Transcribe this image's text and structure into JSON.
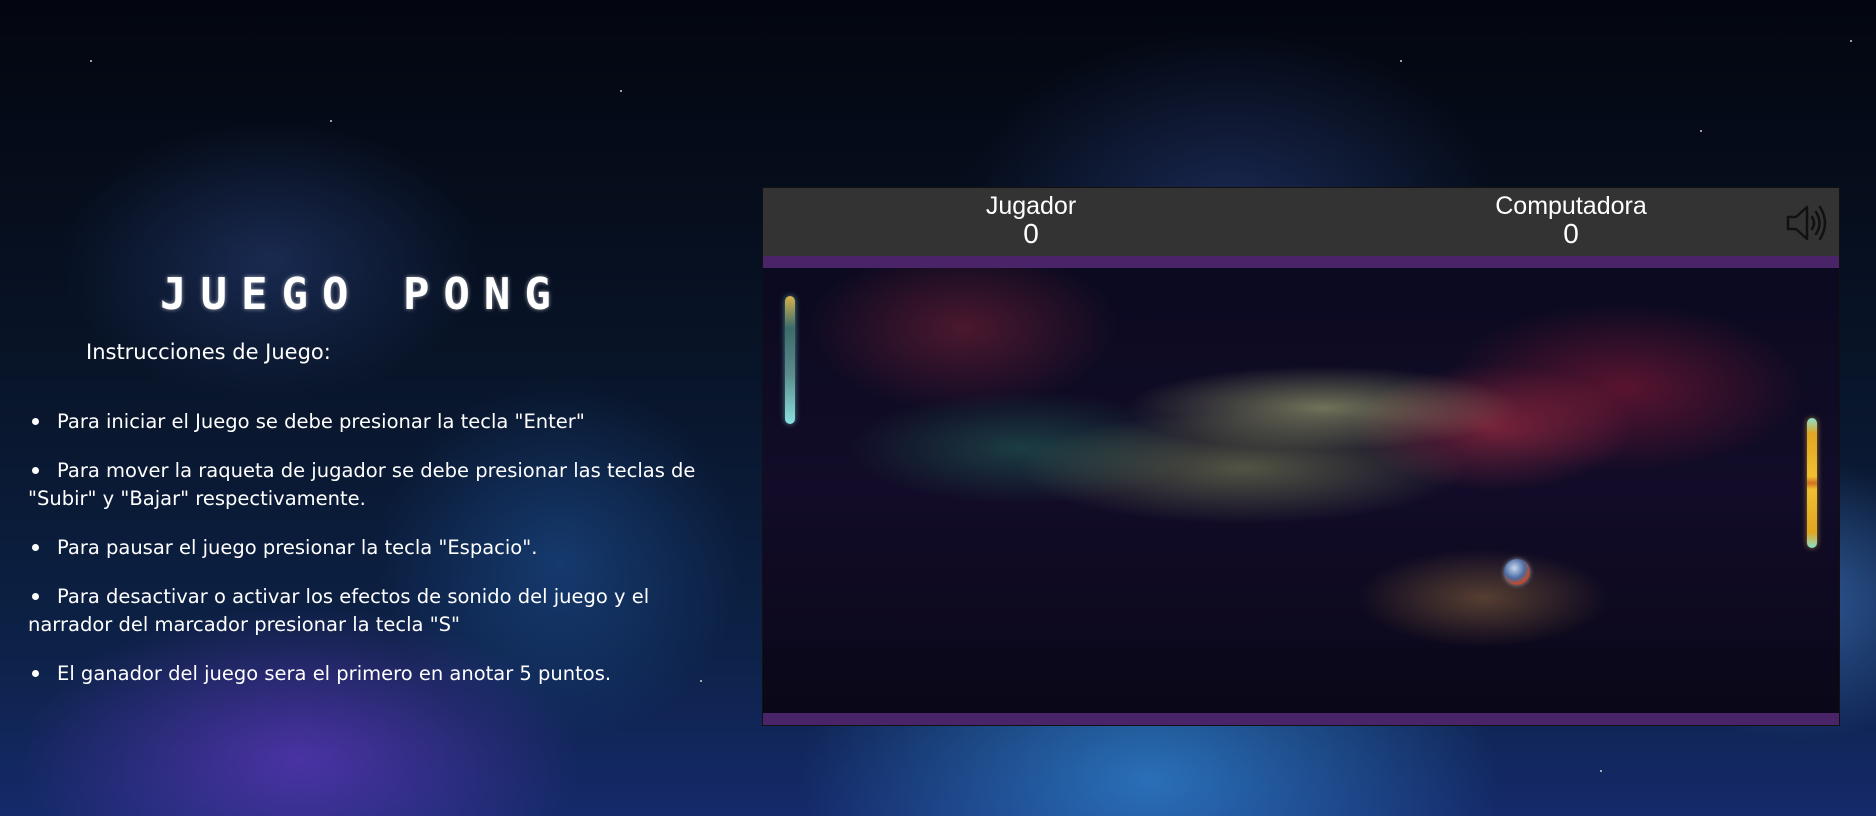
{
  "page": {
    "title": "JUEGO PONG"
  },
  "instructions": {
    "heading": "Instrucciones de Juego:",
    "items": [
      "Para iniciar el Juego se debe presionar la tecla \"Enter\"",
      "Para mover la raqueta de jugador se debe presionar las teclas de \"Subir\" y \"Bajar\" respectivamente.",
      "Para pausar el juego presionar la tecla \"Espacio\".",
      "Para desactivar o activar los efectos de sonido del juego y el narrador del marcador presionar la tecla \"S\"",
      "El ganador del juego sera el primero en anotar 5 puntos."
    ]
  },
  "scoreboard": {
    "player_label": "Jugador",
    "player_score": "0",
    "cpu_label": "Computadora",
    "cpu_score": "0",
    "sound_icon": "speaker-volume-icon"
  },
  "colors": {
    "scorebar": "#333333",
    "divider": "#4a2468",
    "text": "#ffffff"
  }
}
